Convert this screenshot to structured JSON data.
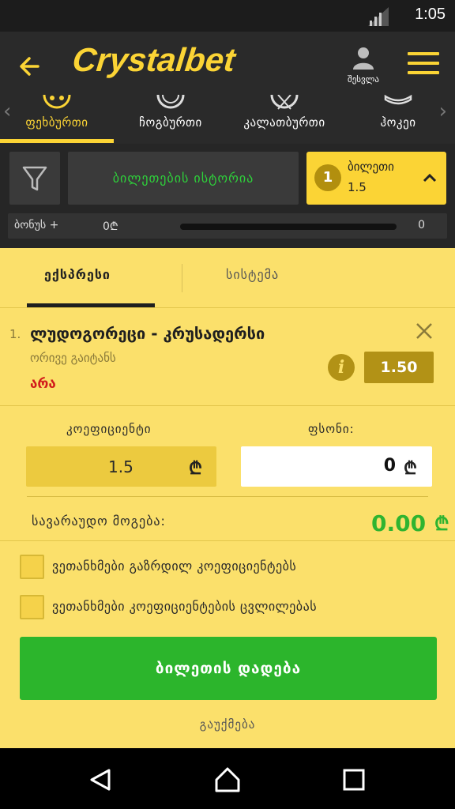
{
  "status_bar": {
    "time": "1:05"
  },
  "header": {
    "logo": "Crystalbet",
    "profile_label": "შესვლა"
  },
  "sport_tabs": [
    {
      "label": "ფეხბურთი",
      "icon": "soccer-ball-icon"
    },
    {
      "label": "ჩოგბურთი",
      "icon": "tennis-ball-icon"
    },
    {
      "label": "კალათბურთი",
      "icon": "basketball-icon"
    },
    {
      "label": "ჰოკეი",
      "icon": "hockey-puck-icon"
    }
  ],
  "toolbar": {
    "history_label": "ბილეთების ისტორია",
    "ticket_count": "1",
    "ticket_label": "ბილეთი",
    "ticket_odds": "1.5"
  },
  "bonus": {
    "label": "ბონუს +",
    "amount": "0₾",
    "progress": 0,
    "right_value": "0"
  },
  "bet_tabs": {
    "express": "ექსპრესი",
    "system": "სისტემა"
  },
  "selection": {
    "number": "1.",
    "event": "ლუდოგორეცი - კრუსადერსი",
    "market": "ორივე გაიტანს",
    "pick": "არა",
    "odds": "1.50"
  },
  "coefficient": {
    "label": "კოეფიციენტი",
    "value": "1.5",
    "currency": "₾"
  },
  "stake": {
    "label": "ფსონი:",
    "value": "0",
    "currency": "₾"
  },
  "payout": {
    "label": "სავარაუდო მოგება:",
    "value": "0.00",
    "currency": "₾"
  },
  "checkboxes": [
    {
      "label": "ვეთანხმები გაზრდილ კოეფიციენტებს",
      "checked": false
    },
    {
      "label": "ვეთანხმები კოეფიციენტების ცვლილებას",
      "checked": false
    }
  ],
  "place_button": "ბილეთის დადება",
  "cancel_link": "გაუქმება",
  "colors": {
    "accent": "#fbd435",
    "panel": "#fbe06b",
    "success": "#2cb52c",
    "danger": "#d21b1b"
  }
}
